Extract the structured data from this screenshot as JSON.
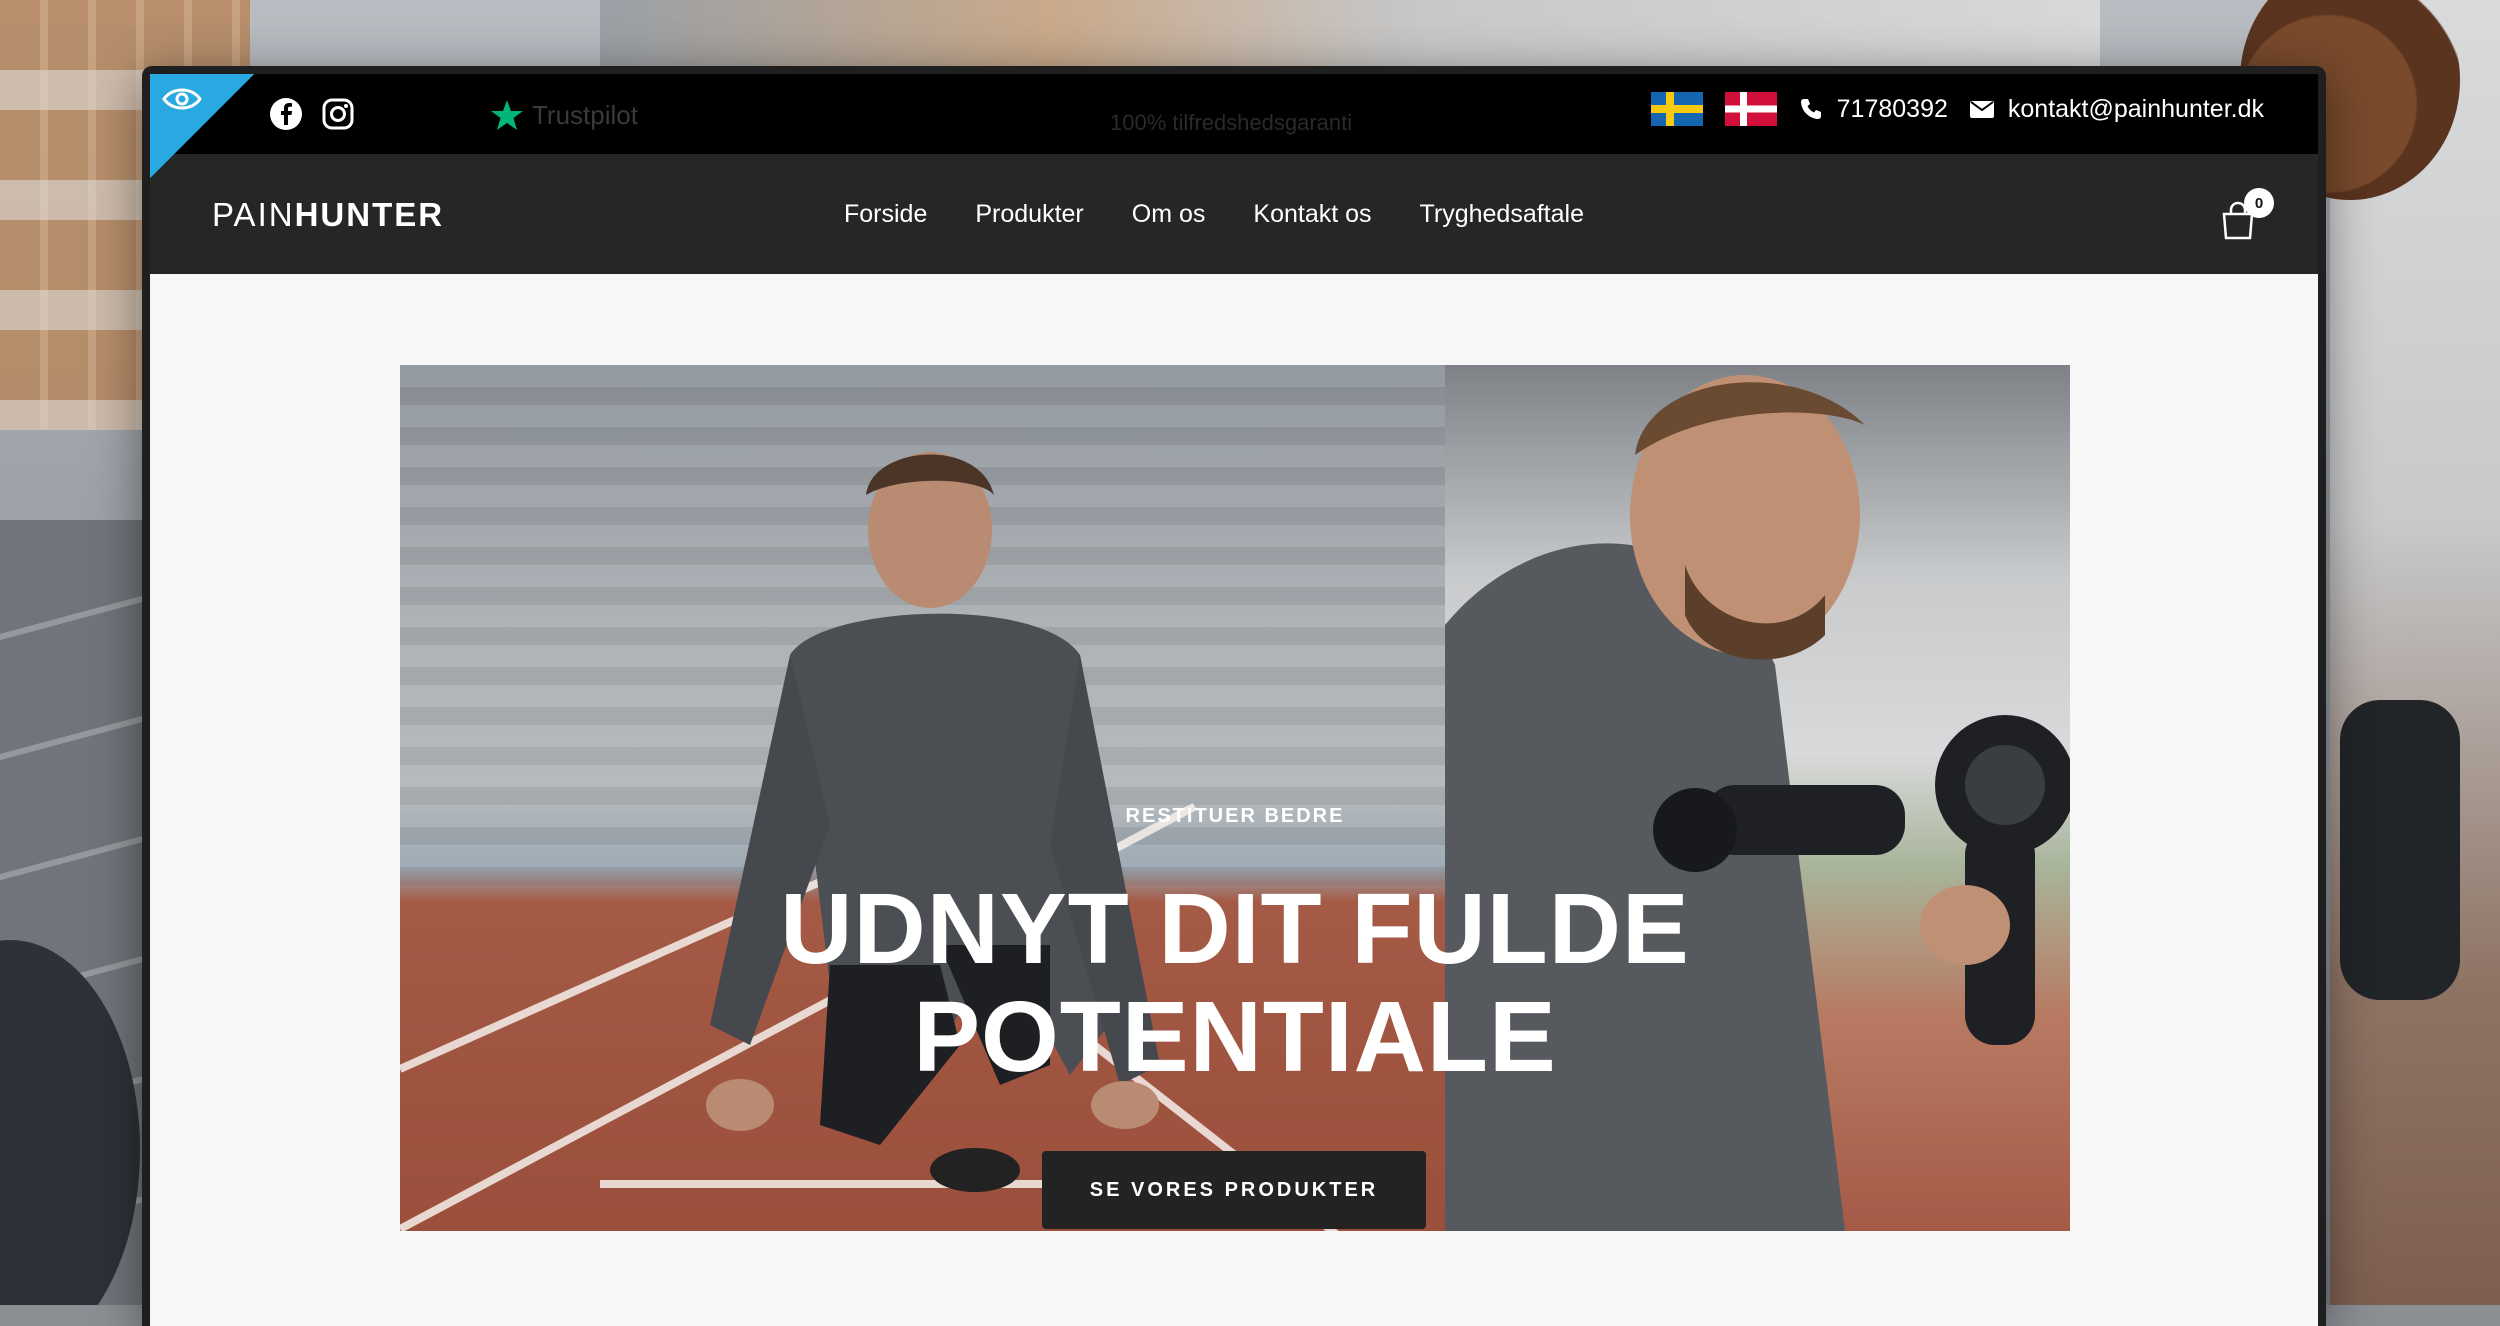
{
  "topbar": {
    "trustpilot_label": "Trustpilot",
    "guarantee_text": "100% tilfredshedsgaranti",
    "phone": "71780392",
    "email": "kontakt@painhunter.dk",
    "accent_color": "#29a9e1",
    "trustpilot_star_color": "#00b67a"
  },
  "nav": {
    "logo_thin": "PAIN",
    "logo_bold": "HUNTER",
    "items": [
      {
        "label": "Forside"
      },
      {
        "label": "Produkter"
      },
      {
        "label": "Om os"
      },
      {
        "label": "Kontakt os"
      },
      {
        "label": "Tryghedsaftale"
      }
    ],
    "cart_count": "0"
  },
  "hero": {
    "eyebrow": "RESTITUER BEDRE",
    "headline_line1": "UDNYT DIT FULDE",
    "headline_line2": "POTENTIALE",
    "cta_label": "SE VORES PRODUKTER"
  }
}
